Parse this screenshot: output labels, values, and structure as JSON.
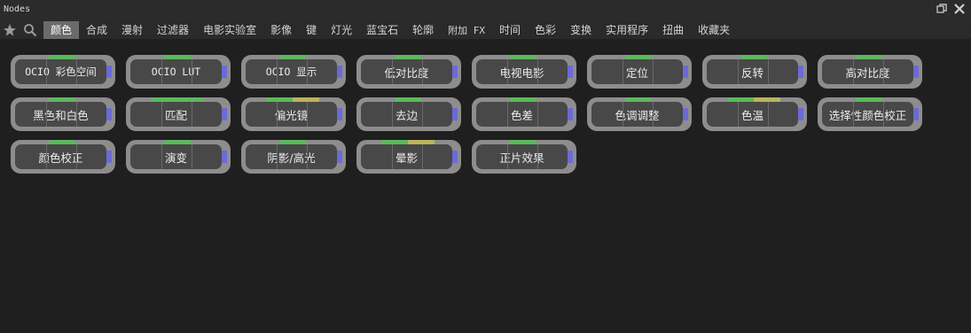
{
  "window": {
    "title": "Nodes"
  },
  "toolbar": {
    "star_icon": "star-icon",
    "search_icon": "search-icon",
    "tabs": [
      {
        "label": "颜色",
        "active": true
      },
      {
        "label": "合成",
        "active": false
      },
      {
        "label": "漫射",
        "active": false
      },
      {
        "label": "过滤器",
        "active": false
      },
      {
        "label": "电影实验室",
        "active": false
      },
      {
        "label": "影像",
        "active": false
      },
      {
        "label": "键",
        "active": false
      },
      {
        "label": "灯光",
        "active": false
      },
      {
        "label": "蓝宝石",
        "active": false
      },
      {
        "label": "轮廓",
        "active": false
      },
      {
        "label": "附加 FX",
        "active": false
      },
      {
        "label": "时间",
        "active": false
      },
      {
        "label": "色彩",
        "active": false
      },
      {
        "label": "变换",
        "active": false
      },
      {
        "label": "实用程序",
        "active": false
      },
      {
        "label": "扭曲",
        "active": false
      },
      {
        "label": "收藏夹",
        "active": false
      }
    ]
  },
  "colors": {
    "input_port": "#5cb85c",
    "matte_port": "#bdb35a",
    "output_port": "#6a6ad8",
    "node_border": "#8d8d8d",
    "node_body": "#484848"
  },
  "nodes": [
    {
      "label": "OCIO  彩色空间",
      "inputs": [
        "#5cb85c"
      ]
    },
    {
      "label": "OCIO LUT",
      "inputs": [
        "#5cb85c"
      ]
    },
    {
      "label": "OCIO 显示",
      "inputs": [
        "#5cb85c"
      ]
    },
    {
      "label": "低对比度",
      "inputs": [
        "#5cb85c"
      ]
    },
    {
      "label": "电视电影",
      "inputs": [
        "#5cb85c"
      ]
    },
    {
      "label": "定位",
      "inputs": [
        "#5cb85c"
      ]
    },
    {
      "label": "反转",
      "inputs": [
        "#5cb85c"
      ]
    },
    {
      "label": "高对比度",
      "inputs": [
        "#5cb85c"
      ]
    },
    {
      "label": "黑色和白色",
      "inputs": [
        "#5cb85c"
      ]
    },
    {
      "label": "匹配",
      "inputs": [
        "#5cb85c",
        "#5cb85c"
      ]
    },
    {
      "label": "偏光镜",
      "inputs": [
        "#5cb85c",
        "#bdb35a"
      ]
    },
    {
      "label": "去边",
      "inputs": [
        "#5cb85c"
      ]
    },
    {
      "label": "色差",
      "inputs": [
        "#5cb85c"
      ]
    },
    {
      "label": "色调调整",
      "inputs": [
        "#5cb85c"
      ]
    },
    {
      "label": "色温",
      "inputs": [
        "#5cb85c",
        "#bdb35a"
      ]
    },
    {
      "label": "选择性颜色校正",
      "inputs": [
        "#5cb85c"
      ]
    },
    {
      "label": "颜色校正",
      "inputs": [
        "#5cb85c"
      ]
    },
    {
      "label": "演变",
      "inputs": [
        "#5cb85c"
      ]
    },
    {
      "label": "阴影/高光",
      "inputs": [
        "#5cb85c"
      ]
    },
    {
      "label": "晕影",
      "inputs": [
        "#5cb85c",
        "#bdb35a"
      ]
    },
    {
      "label": "正片效果",
      "inputs": [
        "#5cb85c"
      ]
    }
  ]
}
